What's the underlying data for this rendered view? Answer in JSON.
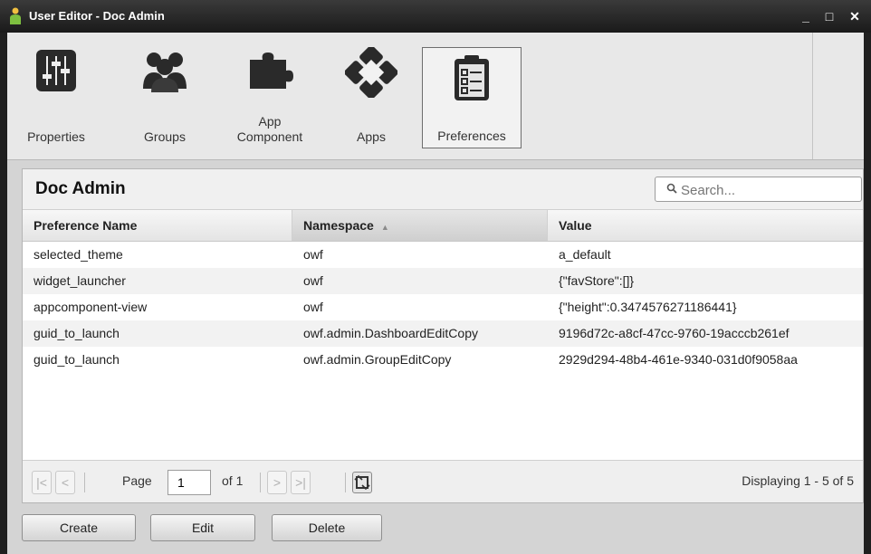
{
  "window": {
    "title": "User Editor - Doc Admin",
    "controls": [
      "minimize-icon",
      "maximize-icon",
      "close-icon"
    ],
    "minimize_glyph": "_",
    "maximize_glyph": "□",
    "close_glyph": "✕"
  },
  "toolbar": {
    "items": [
      {
        "label": "Properties",
        "icon": "sliders-icon",
        "active": false
      },
      {
        "label": "Groups",
        "icon": "group-icon",
        "active": false
      },
      {
        "label": "App\nComponent",
        "icon": "puzzle-icon",
        "active": false
      },
      {
        "label": "Apps",
        "icon": "apps-icon",
        "active": false
      },
      {
        "label": "Preferences",
        "icon": "clipboard-icon",
        "active": true
      }
    ]
  },
  "panel": {
    "title": "Doc Admin",
    "search_placeholder": "Search..."
  },
  "grid": {
    "columns": [
      {
        "label": "Preference Name",
        "sorted": false
      },
      {
        "label": "Namespace",
        "sorted": true,
        "sort_dir": "asc"
      },
      {
        "label": "Value",
        "sorted": false
      }
    ],
    "rows": [
      [
        "selected_theme",
        "owf",
        "a_default"
      ],
      [
        "widget_launcher",
        "owf",
        "{\"favStore\":[]}"
      ],
      [
        "appcomponent-view",
        "owf",
        "{\"height\":0.3474576271186441}"
      ],
      [
        "guid_to_launch",
        "owf.admin.DashboardEditCopy",
        "9196d72c-a8cf-47cc-9760-19acccb261ef"
      ],
      [
        "guid_to_launch",
        "owf.admin.GroupEditCopy",
        "2929d294-48b4-461e-9340-031d0f9058aa"
      ]
    ]
  },
  "pager": {
    "page_label": "Page",
    "page_value": "1",
    "of_label": "of 1",
    "display_info": "Displaying 1 - 5 of 5",
    "first_glyph": "|<",
    "prev_glyph": "<",
    "next_glyph": ">",
    "last_glyph": ">|"
  },
  "actions": {
    "create_label": "Create",
    "edit_label": "Edit",
    "delete_label": "Delete"
  },
  "colors": {
    "titlebar": "#1a1a1a",
    "toolbar_bg": "#e8e8e8",
    "body_bg": "#d4d4d4",
    "active_border": "#6e6e6e"
  }
}
